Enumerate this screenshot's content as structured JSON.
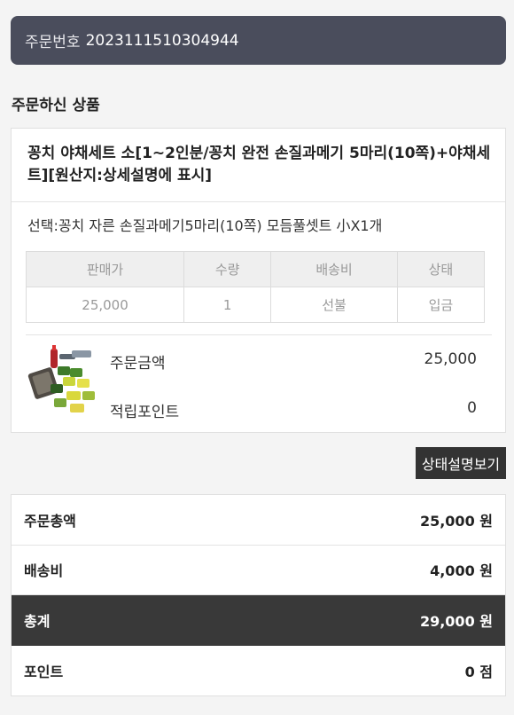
{
  "header": {
    "order_label": "주문번호",
    "order_number": "2023111510304944"
  },
  "section_title": "주문하신 상품",
  "product": {
    "name": "꽁치 야채세트 소[1~2인분/꽁치 완전 손질과메기 5마리(10쪽)+야채세트][원산지:상세설명에 표시]",
    "option": "선택:꽁치 자른 손질과메기5마리(10쪽) 모듬풀셋트 小X1개",
    "table": {
      "headers": [
        "판매가",
        "수량",
        "배송비",
        "상태"
      ],
      "values": [
        "25,000",
        "1",
        "선불",
        "입금"
      ]
    },
    "order_amount_label": "주문금액",
    "order_amount_value": "25,000",
    "points_label": "적립포인트",
    "points_value": "0"
  },
  "status_button_label": "상태설명보기",
  "summary": {
    "order_total_label": "주문총액",
    "order_total_value": "25,000 원",
    "shipping_label": "배송비",
    "shipping_value": "4,000 원",
    "total_label": "총계",
    "total_value": "29,000 원",
    "point_label": "포인트",
    "point_value": "0 점"
  },
  "colors": {
    "header_bg": "#4a4d5c",
    "total_bg": "#393939",
    "button_bg": "#333333"
  },
  "icons": {
    "thumbnail": "product-thumbnail"
  }
}
